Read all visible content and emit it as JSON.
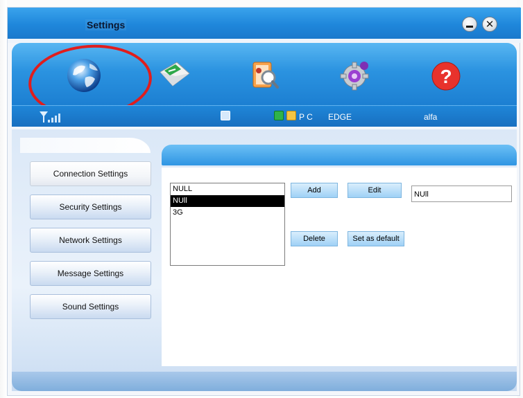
{
  "window": {
    "title": "Settings"
  },
  "toolbar": {
    "items": [
      {
        "name": "connection-globe",
        "icon": "globe-icon"
      },
      {
        "name": "sms-envelope",
        "icon": "envelope-icon"
      },
      {
        "name": "phonebook",
        "icon": "phonebook-icon"
      },
      {
        "name": "settings-gear",
        "icon": "gear-icon"
      },
      {
        "name": "help",
        "icon": "help-icon"
      }
    ]
  },
  "status": {
    "network_mode": "P C",
    "network_type": "EDGE",
    "operator": "alfa"
  },
  "sidebar": {
    "items": [
      {
        "label": "Connection Settings"
      },
      {
        "label": "Security Settings"
      },
      {
        "label": "Network Settings"
      },
      {
        "label": "Message Settings"
      },
      {
        "label": "Sound Settings"
      }
    ]
  },
  "profiles": {
    "items": [
      "NULL",
      "NUll",
      "3G"
    ],
    "selected_index": 1
  },
  "buttons": {
    "add": "Add",
    "edit": "Edit",
    "delete": "Delete",
    "set_default": "Set as default"
  },
  "profile_name_value": "NUll",
  "colors": {
    "title_blue": "#1f87db",
    "highlight_red": "#e01d1d",
    "selection_black": "#000000"
  }
}
